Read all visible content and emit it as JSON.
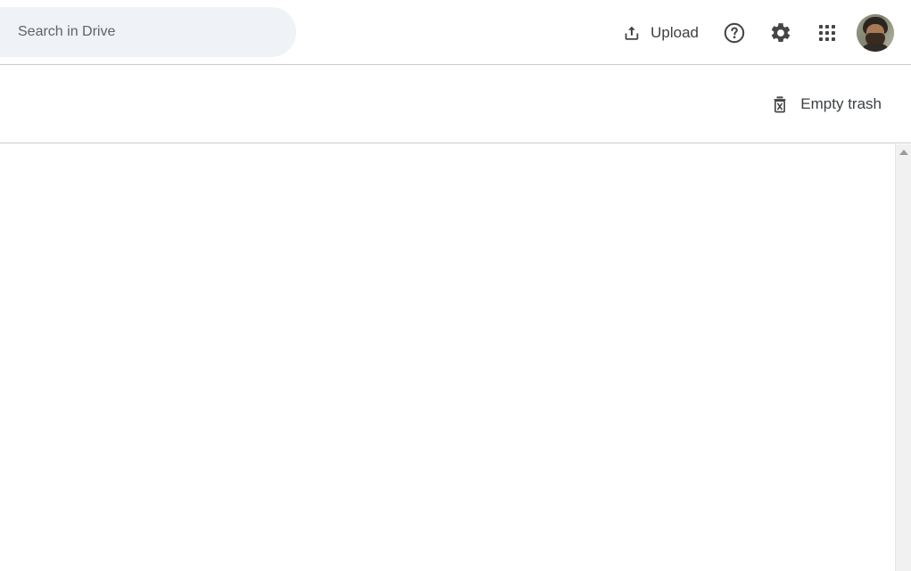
{
  "header": {
    "search": {
      "value": "",
      "placeholder": "Search in Drive",
      "icon": "search-icon"
    },
    "upload": {
      "label": "Upload",
      "icon": "upload-icon"
    },
    "actions": [
      {
        "name": "help-icon",
        "label": "Support"
      },
      {
        "name": "gear-icon",
        "label": "Settings"
      },
      {
        "name": "apps-grid-icon",
        "label": "Google apps"
      }
    ],
    "avatar": {
      "name": "account-avatar",
      "label": "Google Account"
    }
  },
  "toolbar": {
    "empty_trash": {
      "label": "Empty trash",
      "icon": "trash-x-icon"
    }
  },
  "content": {
    "items": [],
    "empty_message": ""
  },
  "scrollbar": {
    "up_arrow": "scroll-up-arrow",
    "position": "top"
  },
  "colors": {
    "search_bg": "#eff2f7",
    "text": "#3c4043",
    "icon": "#444746",
    "divider": "#c8cdd1",
    "scrollbar_track": "#f1f1f1",
    "scrollbar_arrow": "#9a9a9a",
    "page_bg": "#ffffff"
  }
}
